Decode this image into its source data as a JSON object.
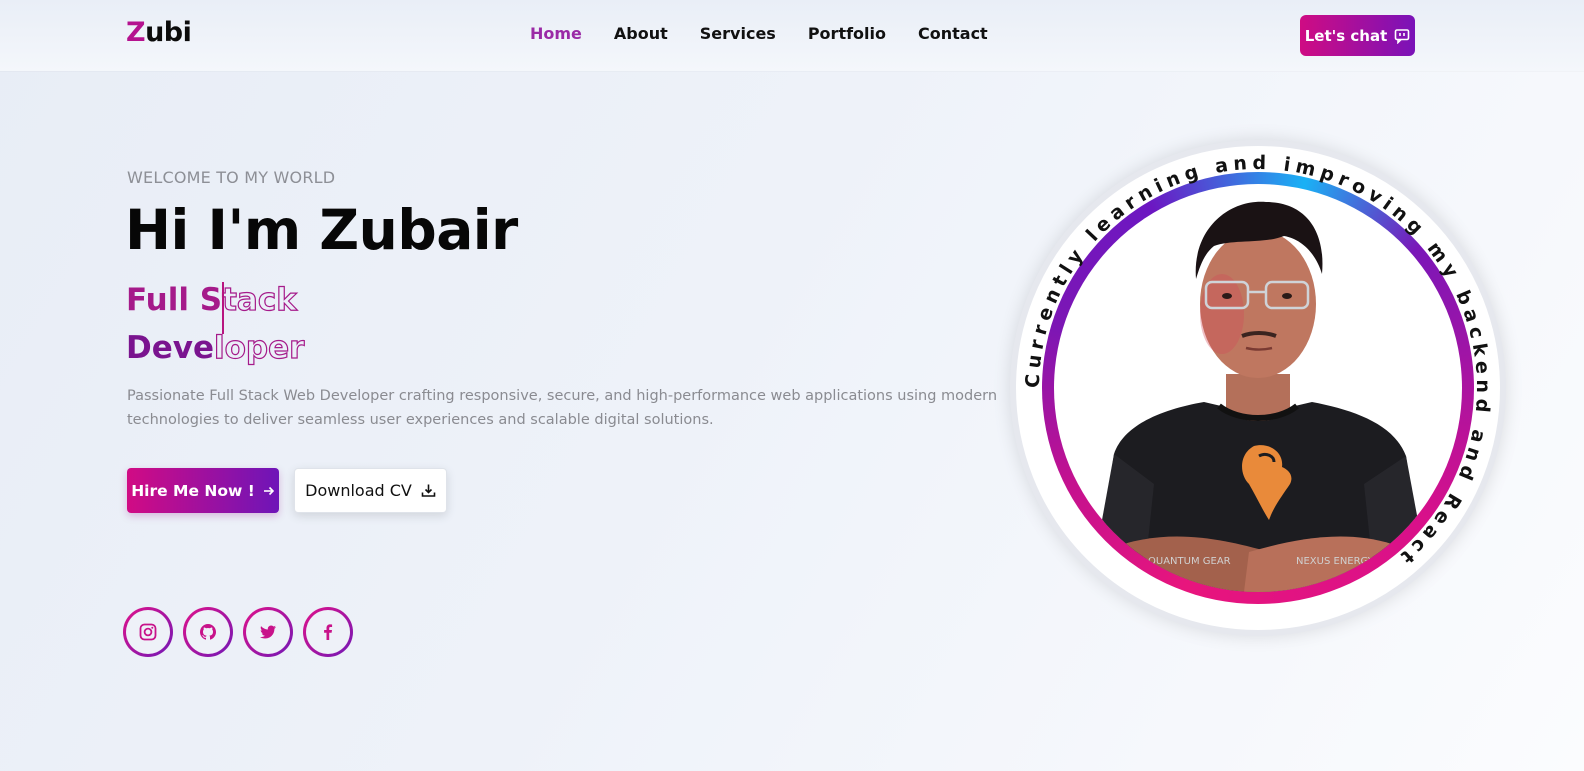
{
  "header": {
    "logo_first": "Z",
    "logo_rest": "ubi",
    "nav": [
      "Home",
      "About",
      "Services",
      "Portfolio",
      "Contact"
    ],
    "active_nav": "Home",
    "chat_button": "Let's chat"
  },
  "hero": {
    "welcome": "WELCOME TO MY WORLD",
    "title": "Hi I'm Zubair",
    "role_line1_filled": "Full S",
    "role_line1_outline": "tack",
    "role_line2_filled": "Deve",
    "role_line2_outline": "loper",
    "description": "Passionate Full Stack Web Developer crafting responsive, secure, and high-performance web applications using modern technologies to deliver seamless user experiences and scalable digital solutions.",
    "hire_button": "Hire Me Now !",
    "cv_button": "Download CV"
  },
  "socials": [
    "instagram-icon",
    "github-icon",
    "twitter-icon",
    "facebook-icon"
  ],
  "profile": {
    "circle_text": "Currently learning and improving my backend and React",
    "shirt_texts": [
      "NEXUS ENERGY",
      "QUANTUM GEAR"
    ]
  },
  "colors": {
    "accent": "#b5128f",
    "gradient_start": "#d10b84",
    "gradient_end": "#6e15b8",
    "nav_active": "#9a2aa6"
  }
}
